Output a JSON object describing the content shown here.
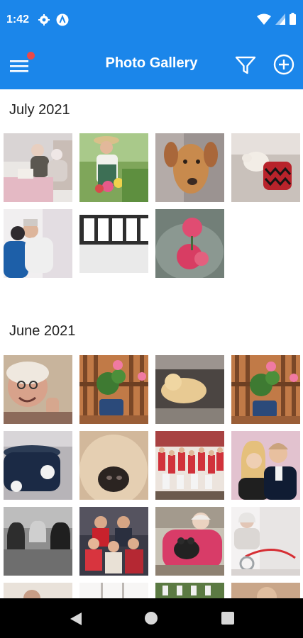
{
  "status_bar": {
    "time": "1:42"
  },
  "app_bar": {
    "title": "Photo Gallery"
  },
  "sections": [
    {
      "title": "July 2021",
      "photos": [
        "elderly-couple-reading",
        "gardener-with-flowers",
        "golden-dog-closeup",
        "dog-on-sofa",
        "caregiver-hug",
        "film-strip",
        "pink-roses"
      ]
    },
    {
      "title": "June 2021",
      "photos": [
        "elderly-woman-smiling",
        "pink-flower-pot-deck",
        "dog-lying-down",
        "pink-flower-pot-deck-2",
        "blue-bowl",
        "dog-nose-closeup",
        "large-family-group",
        "couple-portrait",
        "three-women-bw",
        "family-group",
        "woman-holding-dog",
        "stethoscope-doctor"
      ]
    }
  ],
  "colors": {
    "primary": "#1b86ea",
    "badge": "#e94949",
    "nav": "#000000"
  }
}
